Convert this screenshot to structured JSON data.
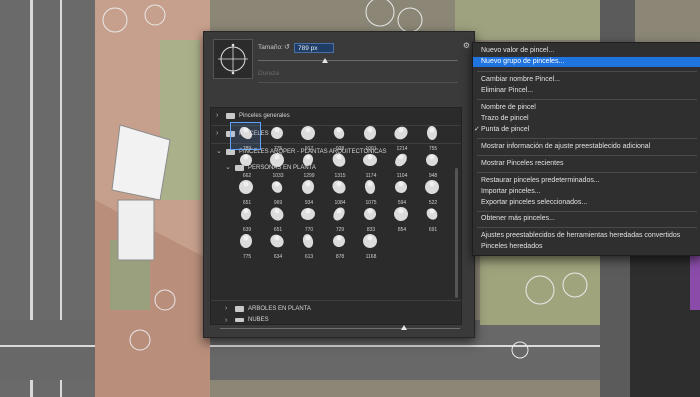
{
  "panel": {
    "size_label": "Tamaño:",
    "size_value": "789 px",
    "hardness_label": "Dureza",
    "gear_icon": "gear-icon"
  },
  "library": {
    "groups": [
      {
        "name": "Pinceles generales",
        "expanded": false
      },
      {
        "name": "PINCELES",
        "expanded": false
      },
      {
        "name": "PINCELES ARQPER - PLANTAS ARQUITECTONICAS",
        "expanded": true
      },
      {
        "name": "PERSONAS EN PLANTA",
        "expanded": true
      },
      {
        "name": "ARBOLES EN PLANTA",
        "expanded": false
      },
      {
        "name": "NUBES",
        "expanded": false
      }
    ],
    "brushes": [
      "789",
      "775",
      "917",
      "928",
      "1091",
      "1214",
      "755",
      "662",
      "1033",
      "1299",
      "1315",
      "1174",
      "1104",
      "948",
      "651",
      "969",
      "934",
      "1084",
      "1075",
      "594",
      "522",
      "639",
      "651",
      "770",
      "729",
      "833",
      "854",
      "691",
      "775",
      "634",
      "613",
      "878",
      "1168"
    ]
  },
  "menu": {
    "items": [
      {
        "label": "Nuevo valor de pincel...",
        "highlight": false
      },
      {
        "label": "Nuevo grupo de pinceles...",
        "highlight": true
      },
      {
        "label": "Cambiar nombre Pincel...",
        "highlight": false
      },
      {
        "label": "Eliminar Pincel...",
        "highlight": false
      },
      {
        "label": "Nombre de pincel",
        "highlight": false
      },
      {
        "label": "Trazo de pincel",
        "highlight": false
      },
      {
        "label": "Punta de pincel",
        "highlight": false,
        "checked": true
      },
      {
        "label": "Mostrar información de ajuste preestablecido adicional",
        "highlight": false
      },
      {
        "label": "Mostrar Pinceles recientes",
        "highlight": false
      },
      {
        "label": "Restaurar pinceles predeterminados...",
        "highlight": false
      },
      {
        "label": "Importar pinceles...",
        "highlight": false
      },
      {
        "label": "Exportar pinceles seleccionados...",
        "highlight": false
      },
      {
        "label": "Obtener más pinceles...",
        "highlight": false
      },
      {
        "label": "Ajustes preestablecidos de herramientas heredadas convertidos",
        "highlight": false
      },
      {
        "label": "Pinceles heredados",
        "highlight": false
      }
    ],
    "check_mark": "✓"
  },
  "colors": {
    "accent": "#1f74e0",
    "panel_bg": "#3a3a3a",
    "menu_bg": "#2f2f2f"
  }
}
